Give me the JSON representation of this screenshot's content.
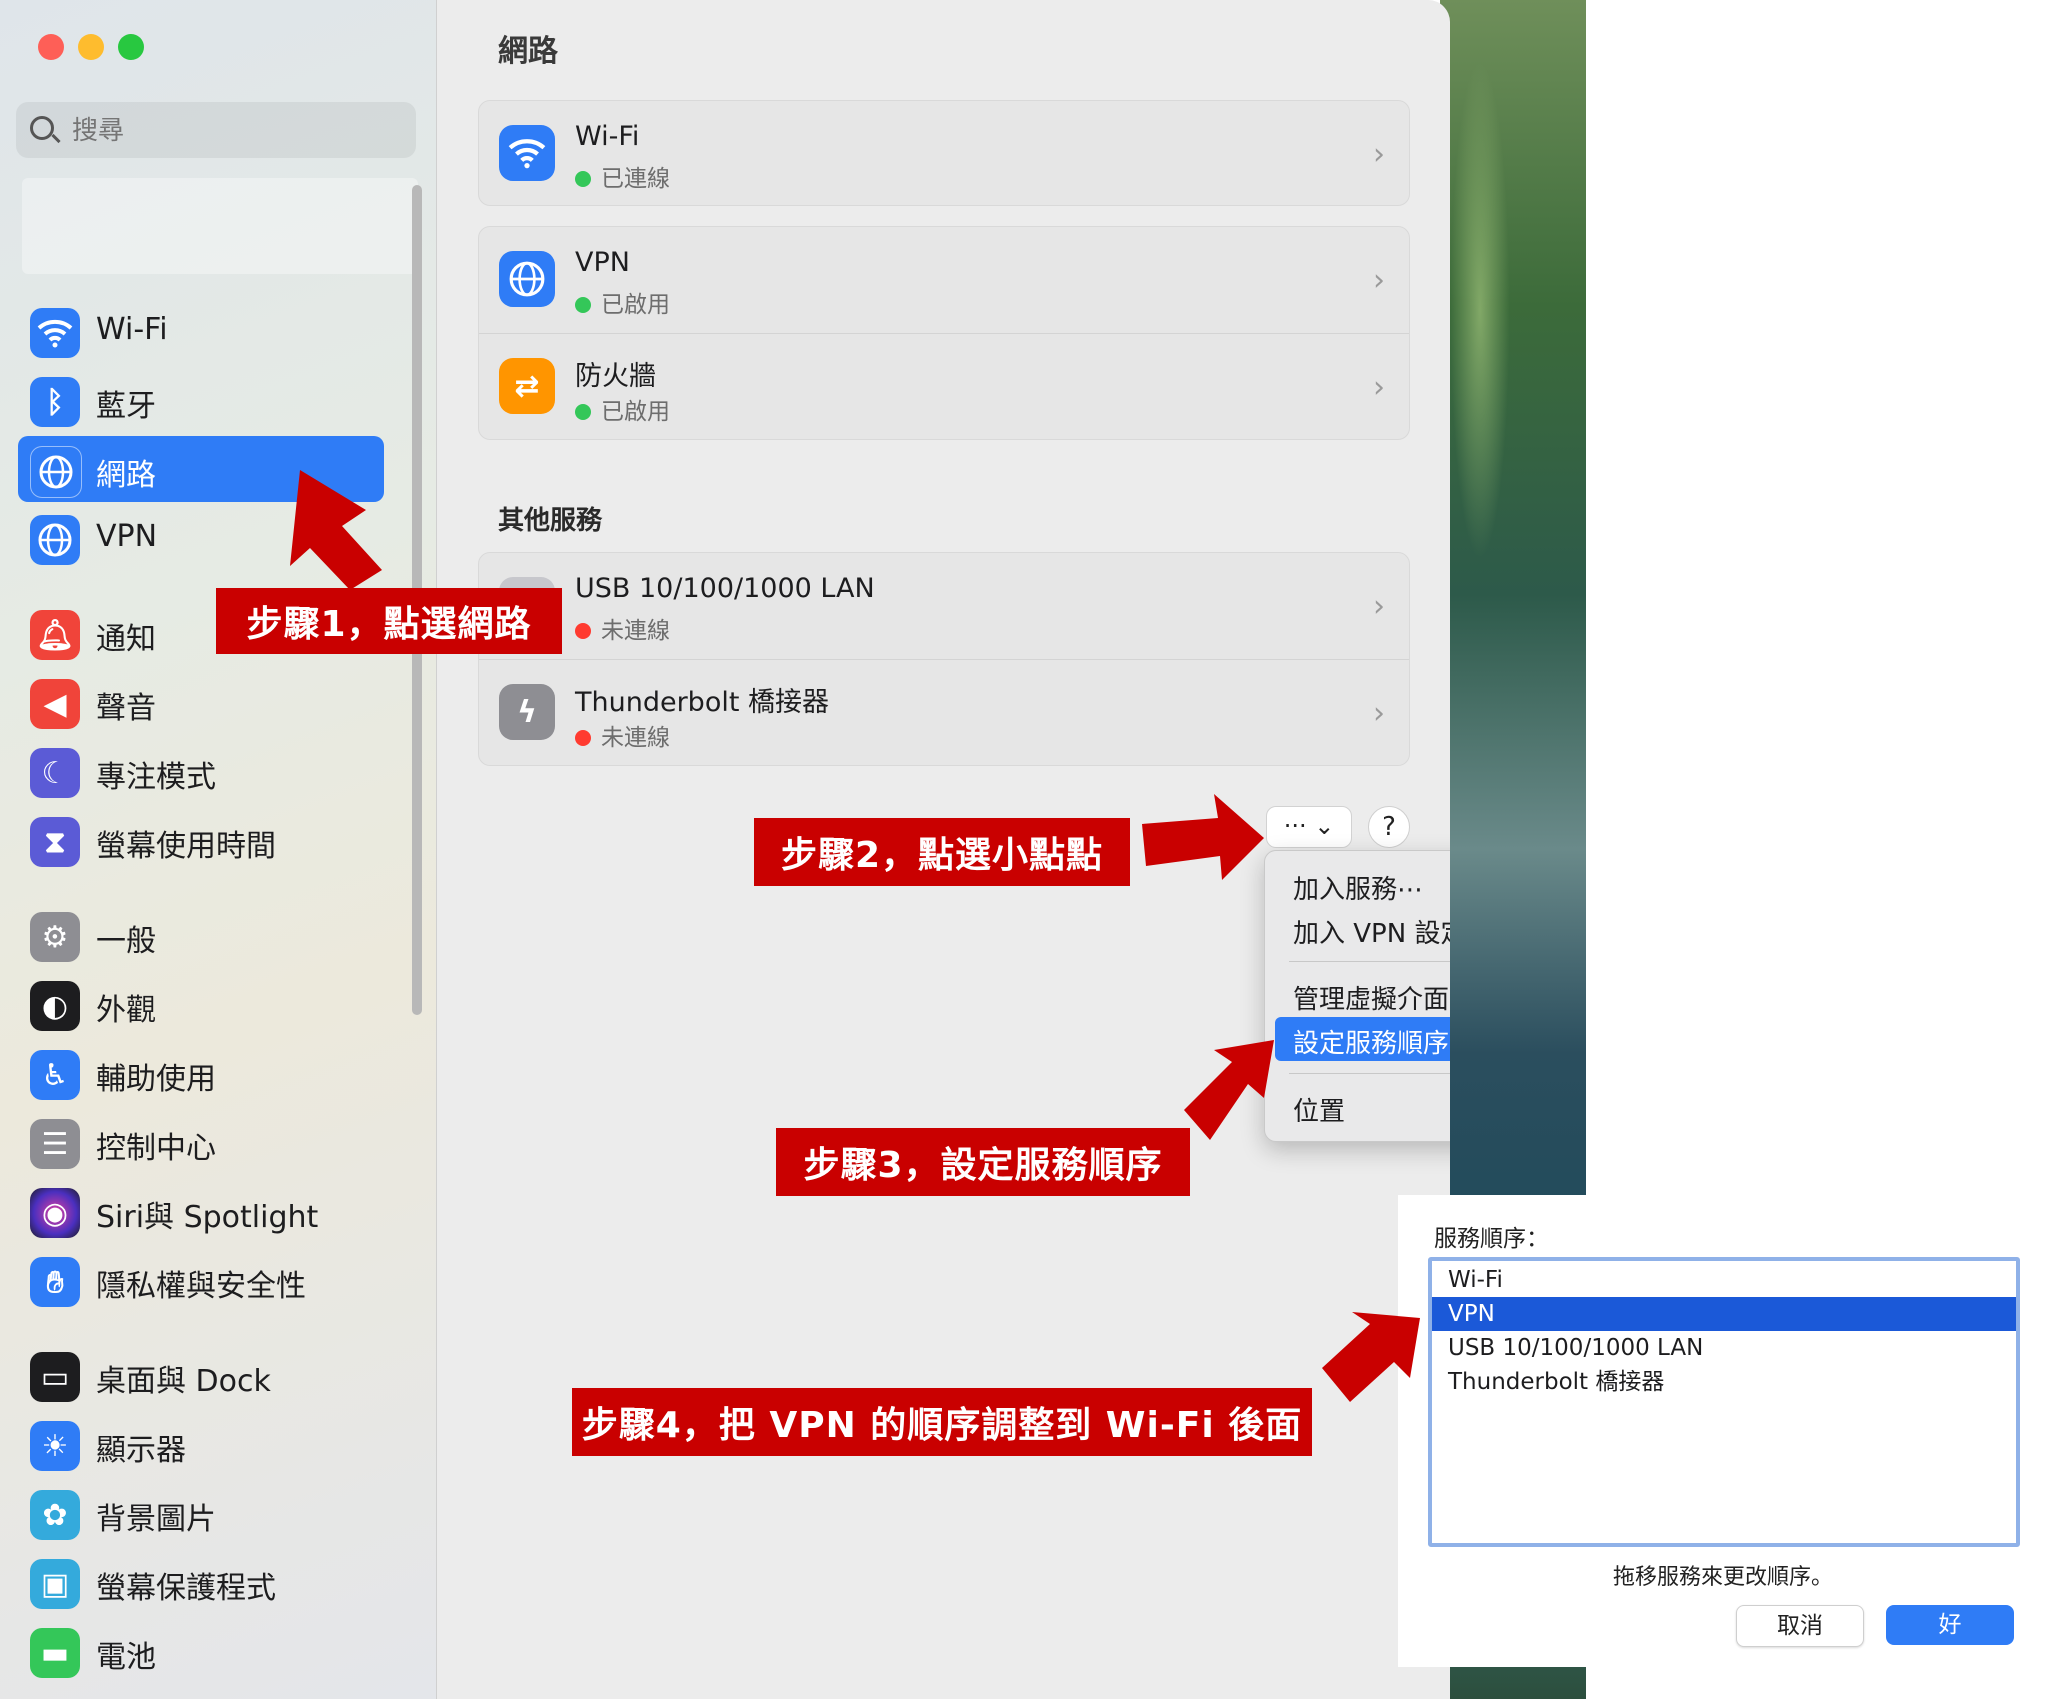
{
  "window": {
    "traffic_lights": {
      "close": "#fe5f57",
      "minimize": "#febc2e",
      "zoom": "#28c840"
    }
  },
  "sidebar": {
    "search_placeholder": "搜尋",
    "items": [
      {
        "label": "Wi-Fi",
        "icon": "wifi-icon",
        "color": "#2f7cf6"
      },
      {
        "label": "藍牙",
        "icon": "bluetooth-icon",
        "color": "#2f7cf6"
      },
      {
        "label": "網路",
        "icon": "globe-icon",
        "color": "#2f7cf6",
        "selected": true
      },
      {
        "label": "VPN",
        "icon": "vpn-globe-icon",
        "color": "#2f7cf6"
      },
      {
        "label": "通知",
        "icon": "bell-icon",
        "color": "#f0443a"
      },
      {
        "label": "聲音",
        "icon": "speaker-icon",
        "color": "#f0443a"
      },
      {
        "label": "專注模式",
        "icon": "moon-icon",
        "color": "#5b5bd6"
      },
      {
        "label": "螢幕使用時間",
        "icon": "hourglass-icon",
        "color": "#5b5bd6"
      },
      {
        "label": "一般",
        "icon": "gear-icon",
        "color": "#8e8e93"
      },
      {
        "label": "外觀",
        "icon": "appearance-icon",
        "color": "#1d1d1f"
      },
      {
        "label": "輔助使用",
        "icon": "accessibility-icon",
        "color": "#2f7cf6"
      },
      {
        "label": "控制中心",
        "icon": "control-center-icon",
        "color": "#8e8e93"
      },
      {
        "label": "Siri與 Spotlight",
        "icon": "siri-icon",
        "color": "#7d3fbf"
      },
      {
        "label": "隱私權與安全性",
        "icon": "hand-icon",
        "color": "#2f7cf6"
      },
      {
        "label": "桌面與 Dock",
        "icon": "dock-icon",
        "color": "#1d1d1f"
      },
      {
        "label": "顯示器",
        "icon": "sun-icon",
        "color": "#2f7cf6"
      },
      {
        "label": "背景圖片",
        "icon": "flower-icon",
        "color": "#34aadc"
      },
      {
        "label": "螢幕保護程式",
        "icon": "screensaver-icon",
        "color": "#34aadc"
      },
      {
        "label": "電池",
        "icon": "battery-icon",
        "color": "#34c759"
      }
    ]
  },
  "main": {
    "title": "網路",
    "services": [
      {
        "name": "Wi-Fi",
        "status": "已連線",
        "status_color": "#34c759",
        "icon": "wifi-icon",
        "color": "#2f7cf6"
      },
      {
        "name": "VPN",
        "status": "已啟用",
        "status_color": "#34c759",
        "icon": "vpn-globe-icon",
        "color": "#2f7cf6"
      },
      {
        "name": "防火牆",
        "status": "已啟用",
        "status_color": "#34c759",
        "icon": "firewall-icon",
        "color": "#ff9500"
      }
    ],
    "other_title": "其他服務",
    "other_services": [
      {
        "name": "USB 10/100/1000 LAN",
        "status": "未連線",
        "status_color": "#ff3b30",
        "icon": "ethernet-icon",
        "color": "#c7c7cc"
      },
      {
        "name": "Thunderbolt 橋接器",
        "status": "未連線",
        "status_color": "#ff3b30",
        "icon": "thunderbolt-icon",
        "color": "#8e8e93"
      }
    ],
    "more_button": "··· ⌄",
    "help_button": "?"
  },
  "menu": {
    "items": [
      {
        "label": "加入服務⋯",
        "submenu": false
      },
      {
        "label": "加入 VPN 設定",
        "submenu": true
      },
      {
        "label": "管理虛擬介面⋯",
        "submenu": false
      },
      {
        "label": "設定服務順序⋯",
        "submenu": false,
        "highlighted": true
      },
      {
        "label": "位置",
        "submenu": true
      }
    ]
  },
  "dialog": {
    "label": "服務順序：",
    "list": [
      "Wi-Fi",
      "VPN",
      "USB 10/100/1000 LAN",
      "Thunderbolt 橋接器"
    ],
    "selected": "VPN",
    "hint": "拖移服務來更改順序。",
    "cancel": "取消",
    "ok": "好"
  },
  "annotations": {
    "step1": "步驟1，點選網路",
    "step2": "步驟2，點選小點點",
    "step3": "步驟3，設定服務順序",
    "step4": "步驟4，把 VPN 的順序調整到 Wi-Fi 後面",
    "color": "#c90000"
  }
}
